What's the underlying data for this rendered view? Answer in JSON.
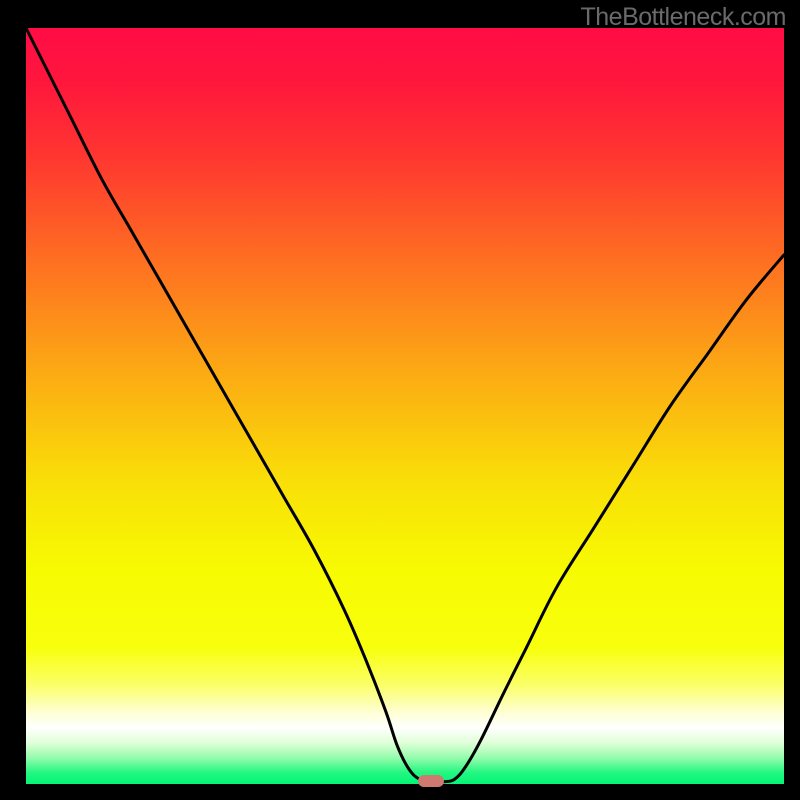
{
  "watermark": "TheBottleneck.com",
  "chart_data": {
    "type": "line",
    "title": "",
    "xlabel": "",
    "ylabel": "",
    "xlim": [
      0,
      100
    ],
    "ylim": [
      0,
      100
    ],
    "gradient_stops": [
      {
        "pos": 0.0,
        "color": "#ff0c45"
      },
      {
        "pos": 0.07,
        "color": "#ff163d"
      },
      {
        "pos": 0.17,
        "color": "#ff3630"
      },
      {
        "pos": 0.3,
        "color": "#fe6c22"
      },
      {
        "pos": 0.45,
        "color": "#fca814"
      },
      {
        "pos": 0.6,
        "color": "#f9df08"
      },
      {
        "pos": 0.72,
        "color": "#f7fb02"
      },
      {
        "pos": 0.82,
        "color": "#f8ff0d"
      },
      {
        "pos": 0.87,
        "color": "#fbff6b"
      },
      {
        "pos": 0.905,
        "color": "#feffd2"
      },
      {
        "pos": 0.925,
        "color": "#ffffff"
      },
      {
        "pos": 0.945,
        "color": "#e1ffd9"
      },
      {
        "pos": 0.965,
        "color": "#96fcad"
      },
      {
        "pos": 0.985,
        "color": "#22f781"
      },
      {
        "pos": 1.0,
        "color": "#04f576"
      }
    ],
    "series": [
      {
        "name": "bottleneck-curve",
        "x": [
          0,
          3,
          6,
          10,
          14,
          18,
          22,
          26,
          30,
          34,
          38,
          42,
          45,
          47.5,
          49,
          50.5,
          52,
          54,
          55,
          56.5,
          58,
          60,
          63,
          66,
          70,
          75,
          80,
          85,
          90,
          95,
          100
        ],
        "values": [
          100,
          94,
          88,
          80,
          73,
          66,
          59,
          52,
          45,
          38,
          31,
          23,
          16,
          9.5,
          5,
          2,
          0.6,
          0.3,
          0.3,
          0.6,
          2.3,
          5.8,
          12,
          18,
          26,
          34,
          42,
          50,
          57,
          64,
          70
        ]
      }
    ],
    "marker": {
      "x": 53.4,
      "y": 0.45,
      "color": "#cf7a70"
    }
  }
}
